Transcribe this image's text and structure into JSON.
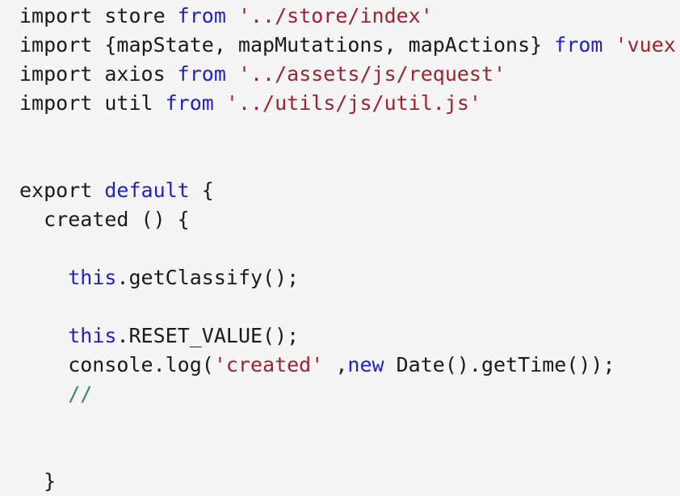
{
  "editor": {
    "background_color": "#f5f5f5",
    "font_size_px": 25,
    "line_height_px": 36,
    "language": "javascript",
    "colors": {
      "plain": "#1a1a1a",
      "keyword": "#2020cc",
      "string": "#9c2230",
      "comment": "#2f8f4f"
    }
  },
  "code": {
    "raw_text": "import store from '../store/index'\nimport {mapState, mapMutations, mapActions} from 'vuex'\nimport axios from '../assets/js/request'\nimport util from '../utils/js/util.js'\n\n\nexport default {\n  created () {\n\n    this.getClassify();\n\n    this.RESET_VALUE();\n    console.log('created' ,new Date().getTime());\n    //\n\n  }",
    "lines": [
      {
        "index": 1,
        "tokens": [
          {
            "text": "import store ",
            "type": "plain"
          },
          {
            "text": "from",
            "type": "keyword"
          },
          {
            "text": " ",
            "type": "plain"
          },
          {
            "text": "'../store/index'",
            "type": "string"
          }
        ]
      },
      {
        "index": 2,
        "tokens": [
          {
            "text": "import {mapState, mapMutations, mapActions} ",
            "type": "plain"
          },
          {
            "text": "from",
            "type": "keyword"
          },
          {
            "text": " ",
            "type": "plain"
          },
          {
            "text": "'vuex'",
            "type": "string"
          }
        ]
      },
      {
        "index": 3,
        "tokens": [
          {
            "text": "import axios ",
            "type": "plain"
          },
          {
            "text": "from",
            "type": "keyword"
          },
          {
            "text": " ",
            "type": "plain"
          },
          {
            "text": "'../assets/js/request'",
            "type": "string"
          }
        ]
      },
      {
        "index": 4,
        "tokens": [
          {
            "text": "import util ",
            "type": "plain"
          },
          {
            "text": "from",
            "type": "keyword"
          },
          {
            "text": " ",
            "type": "plain"
          },
          {
            "text": "'../utils/js/util.js'",
            "type": "string"
          }
        ]
      },
      {
        "index": 5,
        "tokens": []
      },
      {
        "index": 6,
        "tokens": []
      },
      {
        "index": 7,
        "tokens": [
          {
            "text": "export ",
            "type": "plain"
          },
          {
            "text": "default",
            "type": "keyword"
          },
          {
            "text": " {",
            "type": "plain"
          }
        ]
      },
      {
        "index": 8,
        "tokens": [
          {
            "text": "  created () {",
            "type": "plain"
          }
        ]
      },
      {
        "index": 9,
        "tokens": []
      },
      {
        "index": 10,
        "tokens": [
          {
            "text": "    ",
            "type": "plain"
          },
          {
            "text": "this",
            "type": "keyword"
          },
          {
            "text": ".getClassify();",
            "type": "plain"
          }
        ]
      },
      {
        "index": 11,
        "tokens": []
      },
      {
        "index": 12,
        "tokens": [
          {
            "text": "    ",
            "type": "plain"
          },
          {
            "text": "this",
            "type": "keyword"
          },
          {
            "text": ".RESET_VALUE();",
            "type": "plain"
          }
        ]
      },
      {
        "index": 13,
        "tokens": [
          {
            "text": "    console.log(",
            "type": "plain"
          },
          {
            "text": "'created'",
            "type": "string"
          },
          {
            "text": " ,",
            "type": "plain"
          },
          {
            "text": "new",
            "type": "keyword"
          },
          {
            "text": " Date().getTime());",
            "type": "plain"
          }
        ]
      },
      {
        "index": 14,
        "tokens": [
          {
            "text": "    ",
            "type": "plain"
          },
          {
            "text": "//",
            "type": "comment"
          }
        ]
      },
      {
        "index": 15,
        "tokens": []
      },
      {
        "index": 16,
        "tokens": []
      },
      {
        "index": 17,
        "tokens": [
          {
            "text": "  }",
            "type": "plain"
          }
        ]
      }
    ]
  }
}
